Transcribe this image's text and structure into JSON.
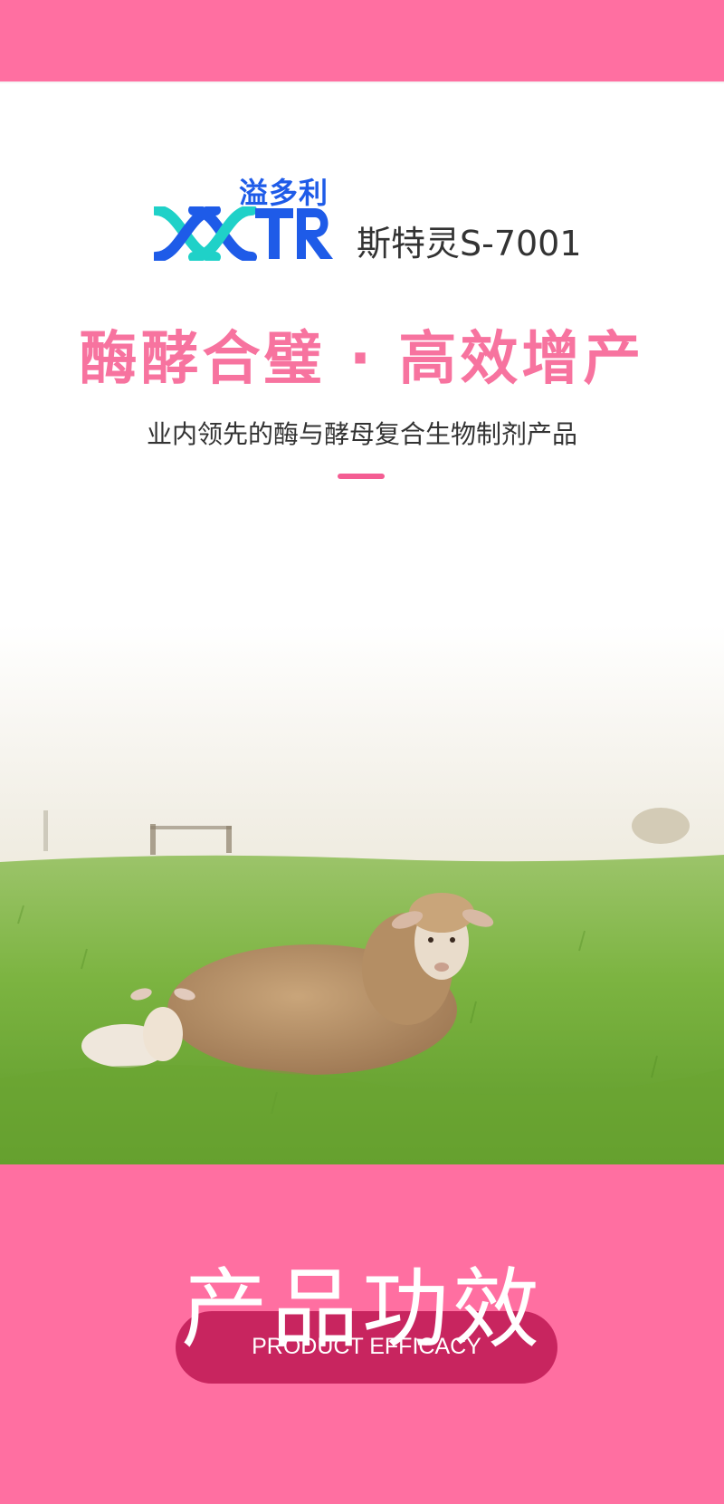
{
  "brand": {
    "name_cn": "溢多利",
    "logo_text": "XXTR",
    "product_name": "斯特灵S-7001"
  },
  "hero": {
    "headline": "酶酵合璧 · 高效增产",
    "subtitle": "业内领先的酶与酵母复合生物制剂产品"
  },
  "photo": {
    "subject": "sheep-on-pasture"
  },
  "efficacy": {
    "title_cn": "产品功效",
    "title_en": "PRODUCT EFFICACY"
  },
  "colors": {
    "pink": "#ff6fa1",
    "headline_pink": "#f7739f",
    "pill": "#c8255f",
    "brand_blue": "#1e5be8",
    "brand_teal": "#1fd1c8"
  }
}
